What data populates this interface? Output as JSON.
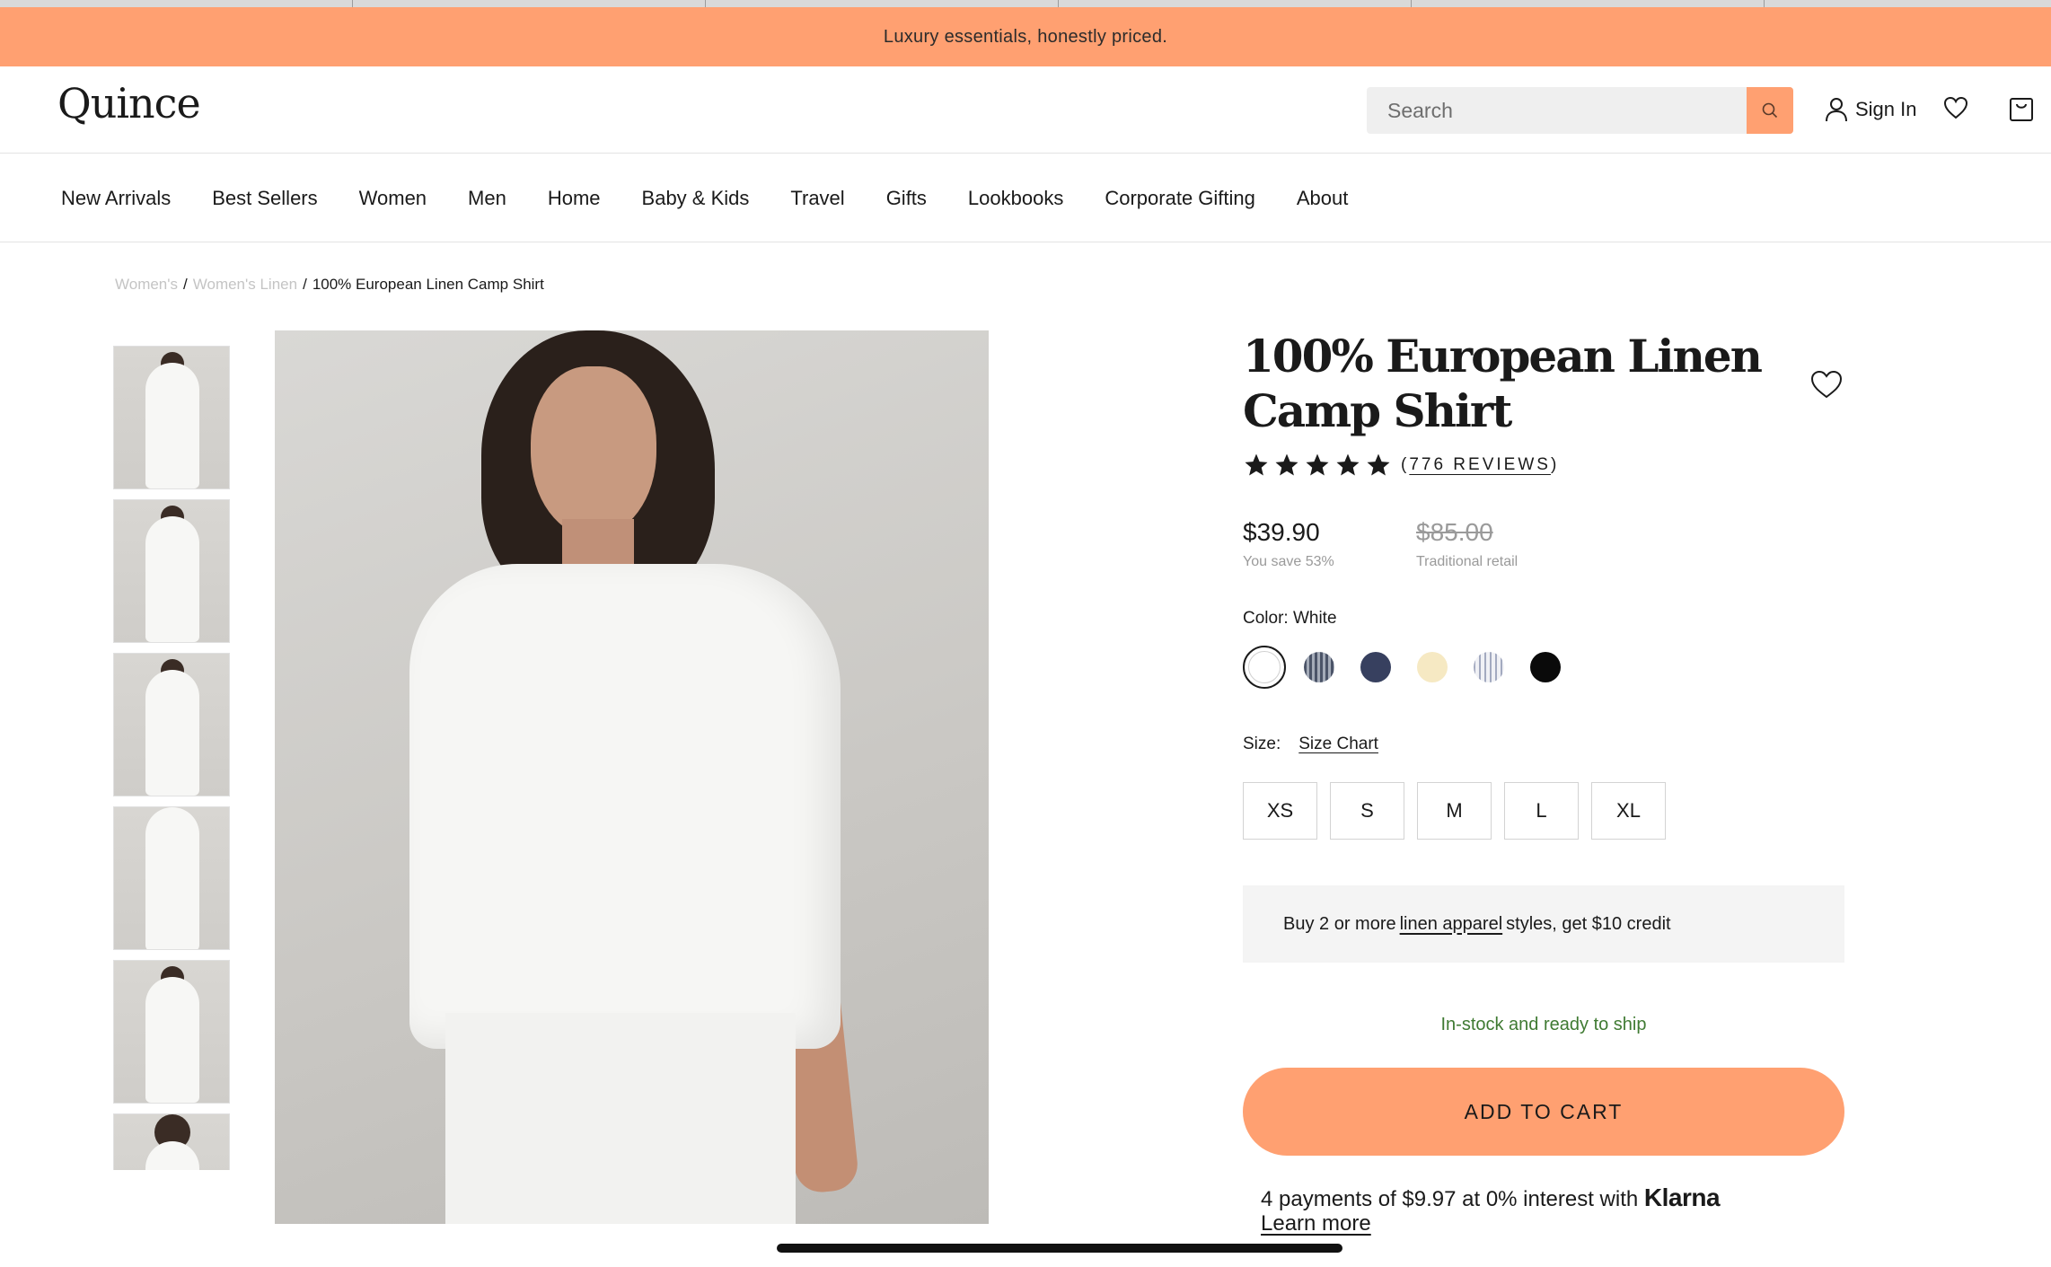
{
  "promo_banner": "Luxury essentials, honestly priced.",
  "brand": {
    "logo": "Quince",
    "accent_color": "#ffa071"
  },
  "header": {
    "search_placeholder": "Search",
    "sign_in": "Sign In"
  },
  "nav": {
    "items": [
      "New Arrivals",
      "Best Sellers",
      "Women",
      "Men",
      "Home",
      "Baby & Kids",
      "Travel",
      "Gifts",
      "Lookbooks",
      "Corporate Gifting",
      "About"
    ]
  },
  "breadcrumb": {
    "items": [
      "Women's",
      "Women's Linen",
      "100% European Linen Camp Shirt"
    ],
    "separator": "/"
  },
  "product": {
    "title": "100% European Linen Camp Shirt",
    "rating": {
      "stars": 5,
      "reviews_label": "776 REVIEWS"
    },
    "price": "$39.90",
    "savings": "You save 53%",
    "original_price": "$85.00",
    "original_label": "Traditional retail",
    "color": {
      "label": "Color: White",
      "swatches": [
        "White",
        "Navy stripe",
        "Navy",
        "Cream",
        "Light stripe",
        "Black"
      ]
    },
    "size": {
      "label": "Size:",
      "chart_link": "Size Chart",
      "options": [
        "XS",
        "S",
        "M",
        "L",
        "XL"
      ]
    },
    "promo": {
      "before": "Buy 2 or more",
      "link": "linen apparel",
      "after": "styles, get $10 credit"
    },
    "stock_status": "In-stock and ready to ship",
    "add_to_cart": "ADD TO CART",
    "klarna": {
      "text": "4 payments of $9.97 at 0% interest with",
      "brand": "Klarna",
      "learn_more": "Learn more"
    }
  },
  "colors": {
    "stock_green": "#3f7a32",
    "muted_text": "#9a9a9a"
  }
}
